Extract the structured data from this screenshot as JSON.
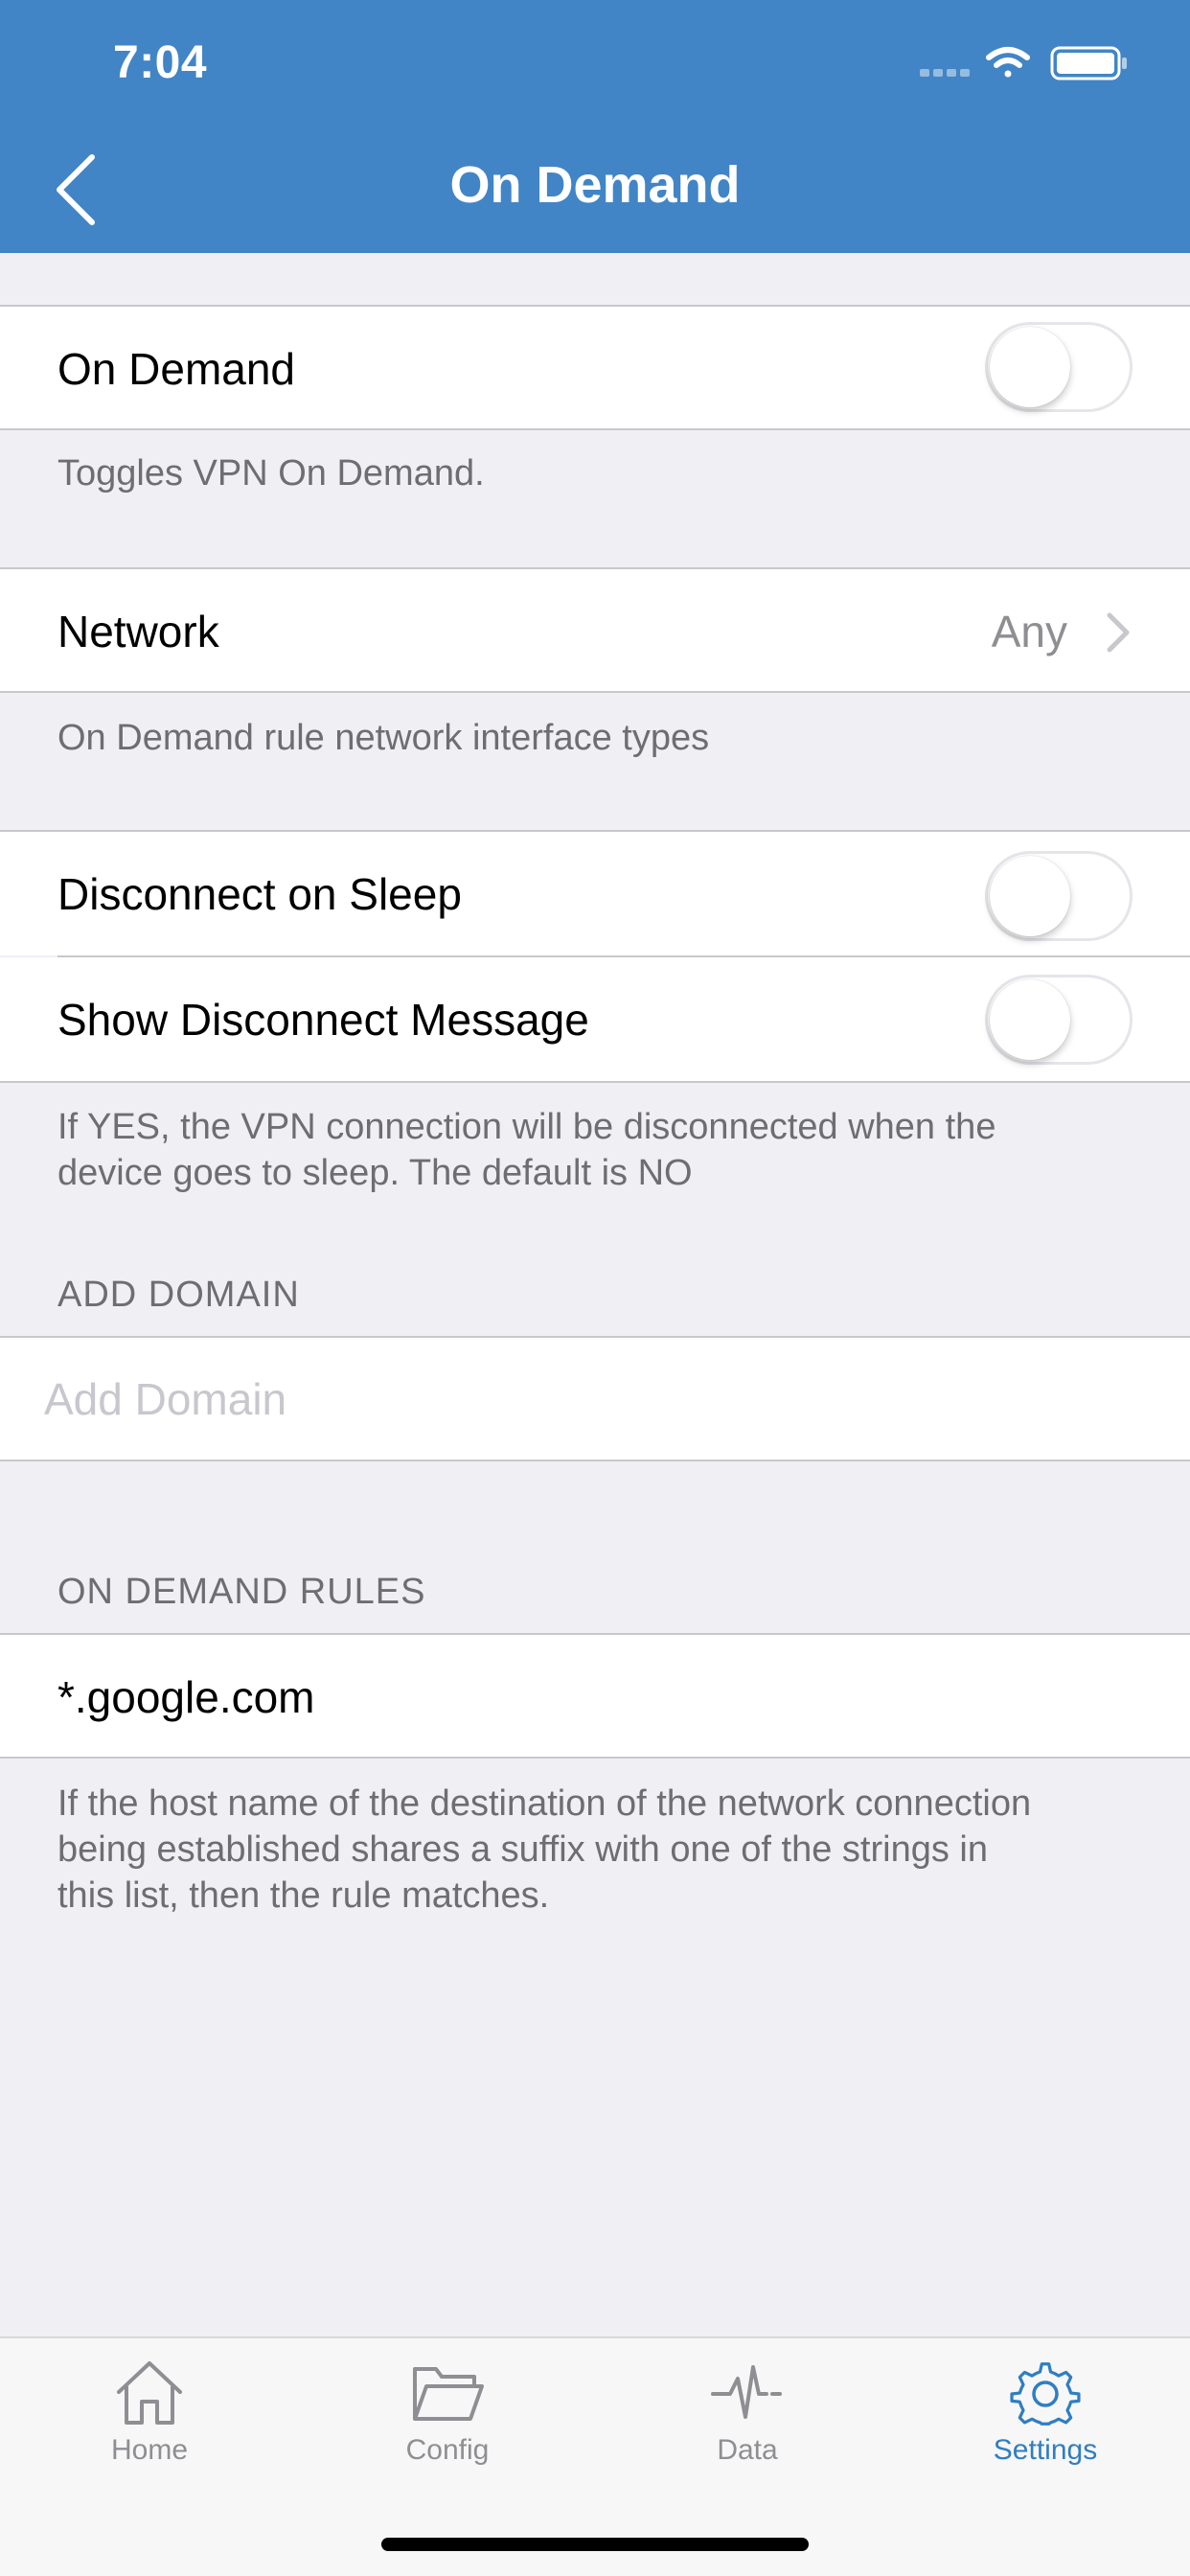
{
  "status_bar": {
    "time": "7:04"
  },
  "nav": {
    "title": "On Demand",
    "back_icon": "chevron-left-icon"
  },
  "on_demand": {
    "label": "On Demand",
    "enabled": false,
    "footer": "Toggles VPN On Demand."
  },
  "network": {
    "label": "Network",
    "value": "Any",
    "footer": "On Demand rule network interface types"
  },
  "sleep": {
    "disconnect_on_sleep": {
      "label": "Disconnect on Sleep",
      "enabled": false
    },
    "show_disconnect_message": {
      "label": "Show Disconnect Message",
      "enabled": false
    },
    "footer_line1": "If YES, the VPN connection will be disconnected when the",
    "footer_line2": "device goes to sleep. The default is NO"
  },
  "add_domain": {
    "header": "ADD DOMAIN",
    "placeholder": "Add Domain",
    "value": ""
  },
  "rules": {
    "header": "ON DEMAND RULES",
    "items": [
      "*.google.com"
    ],
    "footer_line1": "If the host name of the destination of the network connection",
    "footer_line2": "being established shares a suffix with one of the strings in",
    "footer_line3": "this list, then the rule matches."
  },
  "tabbar": {
    "tabs": [
      {
        "label": "Home",
        "icon": "house-icon",
        "active": false
      },
      {
        "label": "Config",
        "icon": "folder-icon",
        "active": false
      },
      {
        "label": "Data",
        "icon": "pulse-icon",
        "active": false
      },
      {
        "label": "Settings",
        "icon": "gear-icon",
        "active": true
      }
    ]
  },
  "colors": {
    "nav": "#4185c6",
    "accent": "#2f7ec1",
    "background": "#efeff4"
  }
}
